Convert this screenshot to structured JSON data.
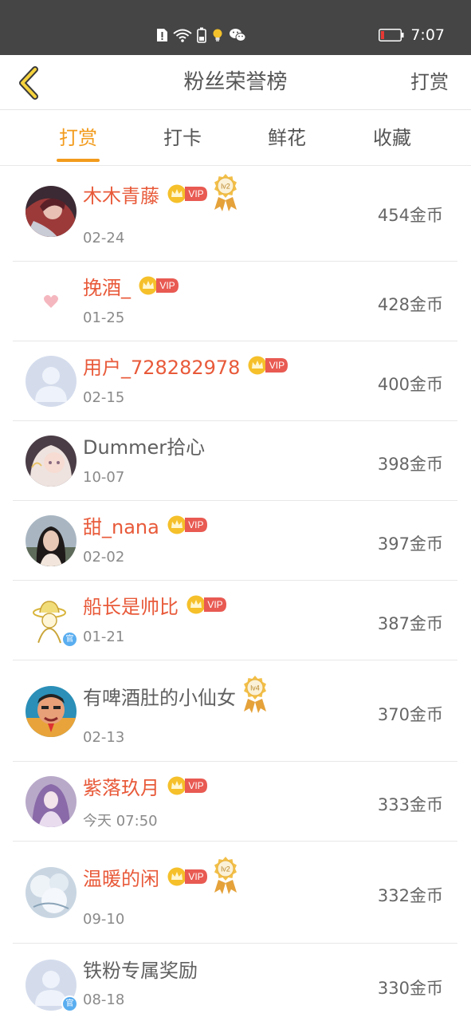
{
  "status_bar": {
    "time": "7:07",
    "icons": [
      "sim-alert-icon",
      "wifi-icon",
      "battery-saver-icon",
      "bulb-icon",
      "wechat-icon"
    ],
    "battery_icon": "battery-low-icon"
  },
  "header": {
    "title": "粉丝荣誉榜",
    "action_label": "打赏",
    "back_icon": "chevron-left-icon"
  },
  "tabs": [
    {
      "label": "打赏",
      "active": true
    },
    {
      "label": "打卡",
      "active": false
    },
    {
      "label": "鲜花",
      "active": false
    },
    {
      "label": "收藏",
      "active": false
    }
  ],
  "colors": {
    "accent": "#f29b1c",
    "vip_name": "#e85a3a",
    "vip_badge": "#e85a52",
    "crown": "#f5c02a",
    "status_bar": "#454545"
  },
  "vip_label": "VIP",
  "fans": [
    {
      "name": "木木青藤",
      "vip": true,
      "medal": "lv2",
      "date": "02-24",
      "amount": "454金币",
      "avatar": "red-anime-avatar",
      "official": false
    },
    {
      "name": "挽酒_",
      "vip": true,
      "medal": "",
      "date": "01-25",
      "amount": "428金币",
      "avatar": "heart-avatar",
      "official": false
    },
    {
      "name": "用户_728282978",
      "vip": true,
      "medal": "",
      "date": "02-15",
      "amount": "400金币",
      "avatar": "default-user-avatar",
      "official": false
    },
    {
      "name": "Dummer拾心",
      "vip": false,
      "medal": "",
      "date": "10-07",
      "amount": "398金币",
      "avatar": "anime-girl-avatar",
      "official": false
    },
    {
      "name": "甜_nana",
      "vip": true,
      "medal": "",
      "date": "02-02",
      "amount": "397金币",
      "avatar": "photo-woman-avatar",
      "official": false
    },
    {
      "name": "船长是帅比",
      "vip": true,
      "medal": "",
      "date": "01-21",
      "amount": "387金币",
      "avatar": "straw-hat-avatar",
      "official": true
    },
    {
      "name": "有啤酒肚的小仙女",
      "vip": false,
      "medal": "lv4",
      "date": "02-13",
      "amount": "370金币",
      "avatar": "cartoon-man-avatar",
      "official": false
    },
    {
      "name": "紫落玖月",
      "vip": true,
      "medal": "",
      "date": "今天 07:50",
      "amount": "333金币",
      "avatar": "purple-fairy-avatar",
      "official": false
    },
    {
      "name": "温暖的闲",
      "vip": true,
      "medal": "lv2",
      "date": "09-10",
      "amount": "332金币",
      "avatar": "snow-tree-avatar",
      "official": false
    },
    {
      "name": "铁粉专属奖励",
      "vip": false,
      "medal": "",
      "date": "08-18",
      "amount": "330金币",
      "avatar": "default-user-avatar",
      "official": true
    }
  ]
}
